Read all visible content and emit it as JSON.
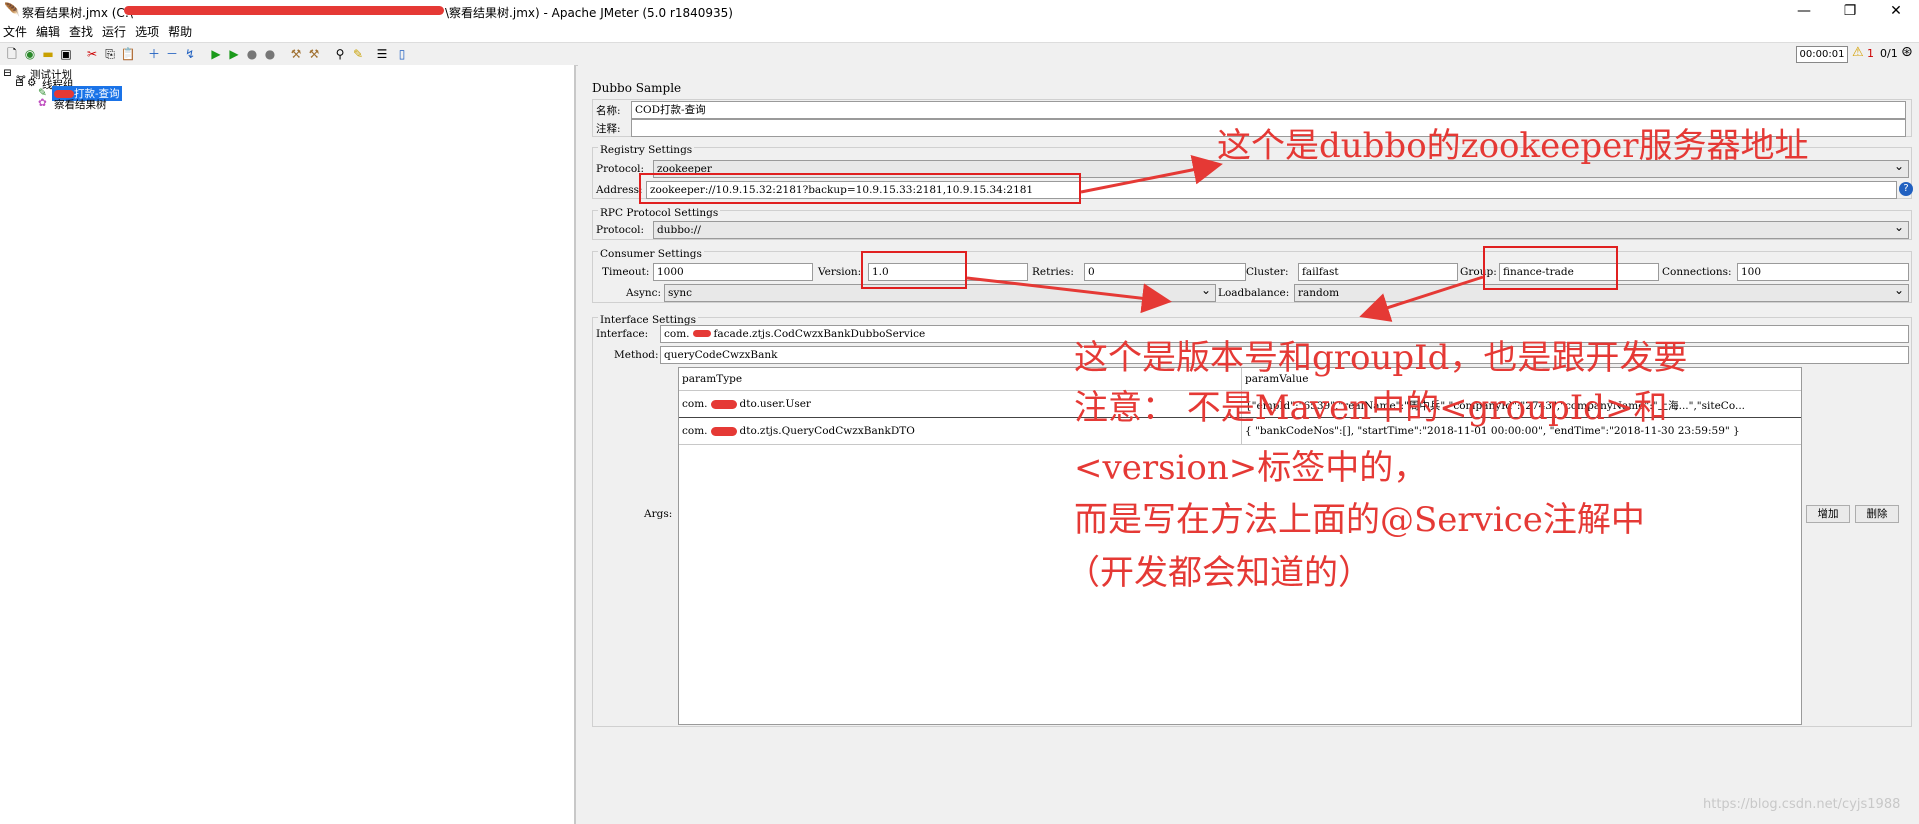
{
  "window": {
    "title_left": "察看结果树.jmx (C:\\",
    "title_right": "\\察看结果树.jmx) - Apache JMeter (5.0 r1840935)"
  },
  "menu": [
    "文件",
    "编辑",
    "查找",
    "运行",
    "选项",
    "帮助"
  ],
  "toolbar": {
    "timer": "00:00:01",
    "warn_count": "1",
    "threads": "0/1"
  },
  "tree": {
    "root": "测试计划",
    "thread_group": "线程组",
    "sampler": "打款-查询",
    "listener": "察看结果树"
  },
  "panel": {
    "title": "Dubbo Sample",
    "name_label": "名称:",
    "name_value": "COD打款-查询",
    "comment_label": "注释:",
    "registry": {
      "header": "Registry Settings",
      "protocol_label": "Protocol:",
      "protocol_value": "zookeeper",
      "address_label": "Address:",
      "address_value": "zookeeper://10.9.15.32:2181?backup=10.9.15.33:2181,10.9.15.34:2181"
    },
    "rpc": {
      "header": "RPC Protocol Settings",
      "protocol_label": "Protocol:",
      "protocol_value": "dubbo://"
    },
    "consumer": {
      "header": "Consumer Settings",
      "timeout_label": "Timeout:",
      "timeout_value": "1000",
      "version_label": "Version:",
      "version_value": "1.0",
      "retries_label": "Retries:",
      "retries_value": "0",
      "cluster_label": "Cluster:",
      "cluster_value": "failfast",
      "group_label": "Group:",
      "group_value": "finance-trade",
      "connections_label": "Connections:",
      "connections_value": "100",
      "async_label": "Async:",
      "async_value": "sync",
      "loadbalance_label": "Loadbalance:",
      "loadbalance_value": "random"
    },
    "interface": {
      "header": "Interface Settings",
      "interface_label": "Interface:",
      "interface_prefix": "com.",
      "interface_suffix": "facade.ztjs.CodCwzxBankDubboService",
      "method_label": "Method:",
      "method_value": "queryCodeCwzxBank",
      "args_label": "Args:",
      "col_type": "paramType",
      "col_value": "paramValue",
      "rows": [
        {
          "type_prefix": "com.",
          "type_suffix": "dto.user.User",
          "value": "{\"empId\":\"6539\",\"realName\":\"周中兵\",\"companyId\":\"2743\",\"companyName\":\"上海...\",\"siteCo..."
        },
        {
          "type_prefix": "com.",
          "type_suffix": "dto.ztjs.QueryCodCwzxBankDTO",
          "value": "{ \"bankCodeNos\":[], \"startTime\":\"2018-11-01 00:00:00\", \"endTime\":\"2018-11-30 23:59:59\" }"
        }
      ],
      "add_button": "增加",
      "delete_button": "删除"
    }
  },
  "annotations": {
    "zk": "这个是dubbo的zookeeper服务器地址",
    "line1": "这个是版本号和groupId，也是跟开发要",
    "line2": "注意：  不是Maven中的<groupId>和",
    "line3": "<version>标签中的，",
    "line4": "而是写在方法上面的@Service注解中",
    "line5": "（开发都会知道的）"
  },
  "watermark": "https://blog.csdn.net/cyjs1988",
  "colors": {
    "annotation_red": "#e53935",
    "selection_blue": "#1a73e8"
  }
}
